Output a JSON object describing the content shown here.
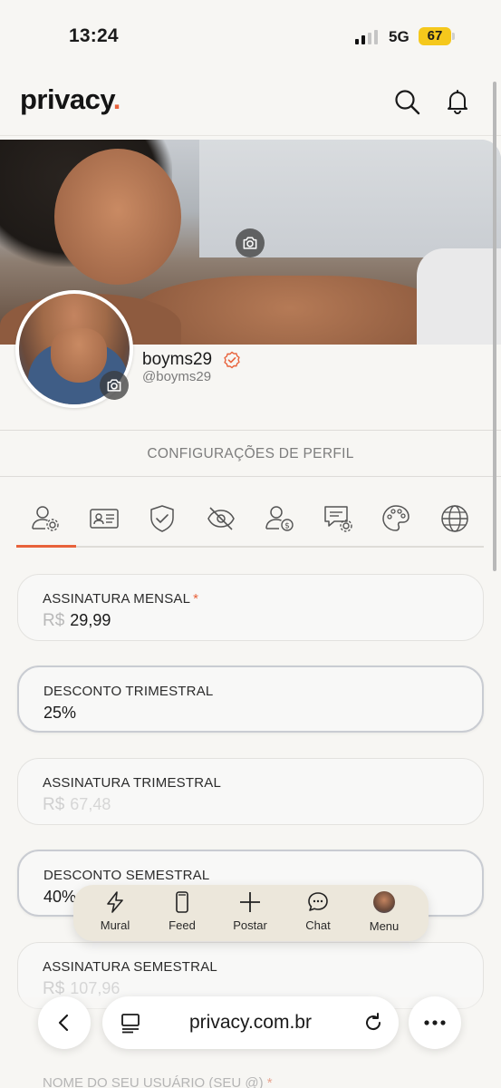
{
  "status_bar": {
    "time": "13:24",
    "network": "5G",
    "battery": "67"
  },
  "header": {
    "logo_text": "privacy",
    "logo_dot": "."
  },
  "profile": {
    "display_name": "boyms29",
    "handle": "@boyms29"
  },
  "section_title": "CONFIGURAÇÕES DE PERFIL",
  "tabs": [
    {
      "icon": "user-gear-icon",
      "active": true
    },
    {
      "icon": "id-card-icon",
      "active": false
    },
    {
      "icon": "shield-check-icon",
      "active": false
    },
    {
      "icon": "eye-off-icon",
      "active": false
    },
    {
      "icon": "user-dollar-icon",
      "active": false
    },
    {
      "icon": "chat-gear-icon",
      "active": false
    },
    {
      "icon": "palette-icon",
      "active": false
    },
    {
      "icon": "globe-icon",
      "active": false
    }
  ],
  "fields": [
    {
      "label": "ASSINATURA MENSAL",
      "required": "*",
      "currency": "R$",
      "value": "29,99"
    },
    {
      "label": "DESCONTO TRIMESTRAL",
      "value": "25%"
    },
    {
      "label": "ASSINATURA TRIMESTRAL",
      "currency": "R$",
      "value": "67,48"
    },
    {
      "label": "DESCONTO SEMESTRAL",
      "value": "40%"
    },
    {
      "label": "ASSINATURA SEMESTRAL",
      "currency": "R$",
      "value": "107,96"
    },
    {
      "label": "NOME DO SEU USUÁRIO (SEU @)",
      "required": "*"
    }
  ],
  "dock": [
    {
      "label": "Mural",
      "icon": "lightning-icon"
    },
    {
      "label": "Feed",
      "icon": "phone-icon"
    },
    {
      "label": "Postar",
      "icon": "plus-icon"
    },
    {
      "label": "Chat",
      "icon": "chat-bubble-icon"
    },
    {
      "label": "Menu",
      "icon": "avatar"
    }
  ],
  "browser": {
    "url": "privacy.com.br"
  },
  "colors": {
    "accent": "#e8623b",
    "battery": "#f5c81c",
    "dock": "#ece7db"
  }
}
